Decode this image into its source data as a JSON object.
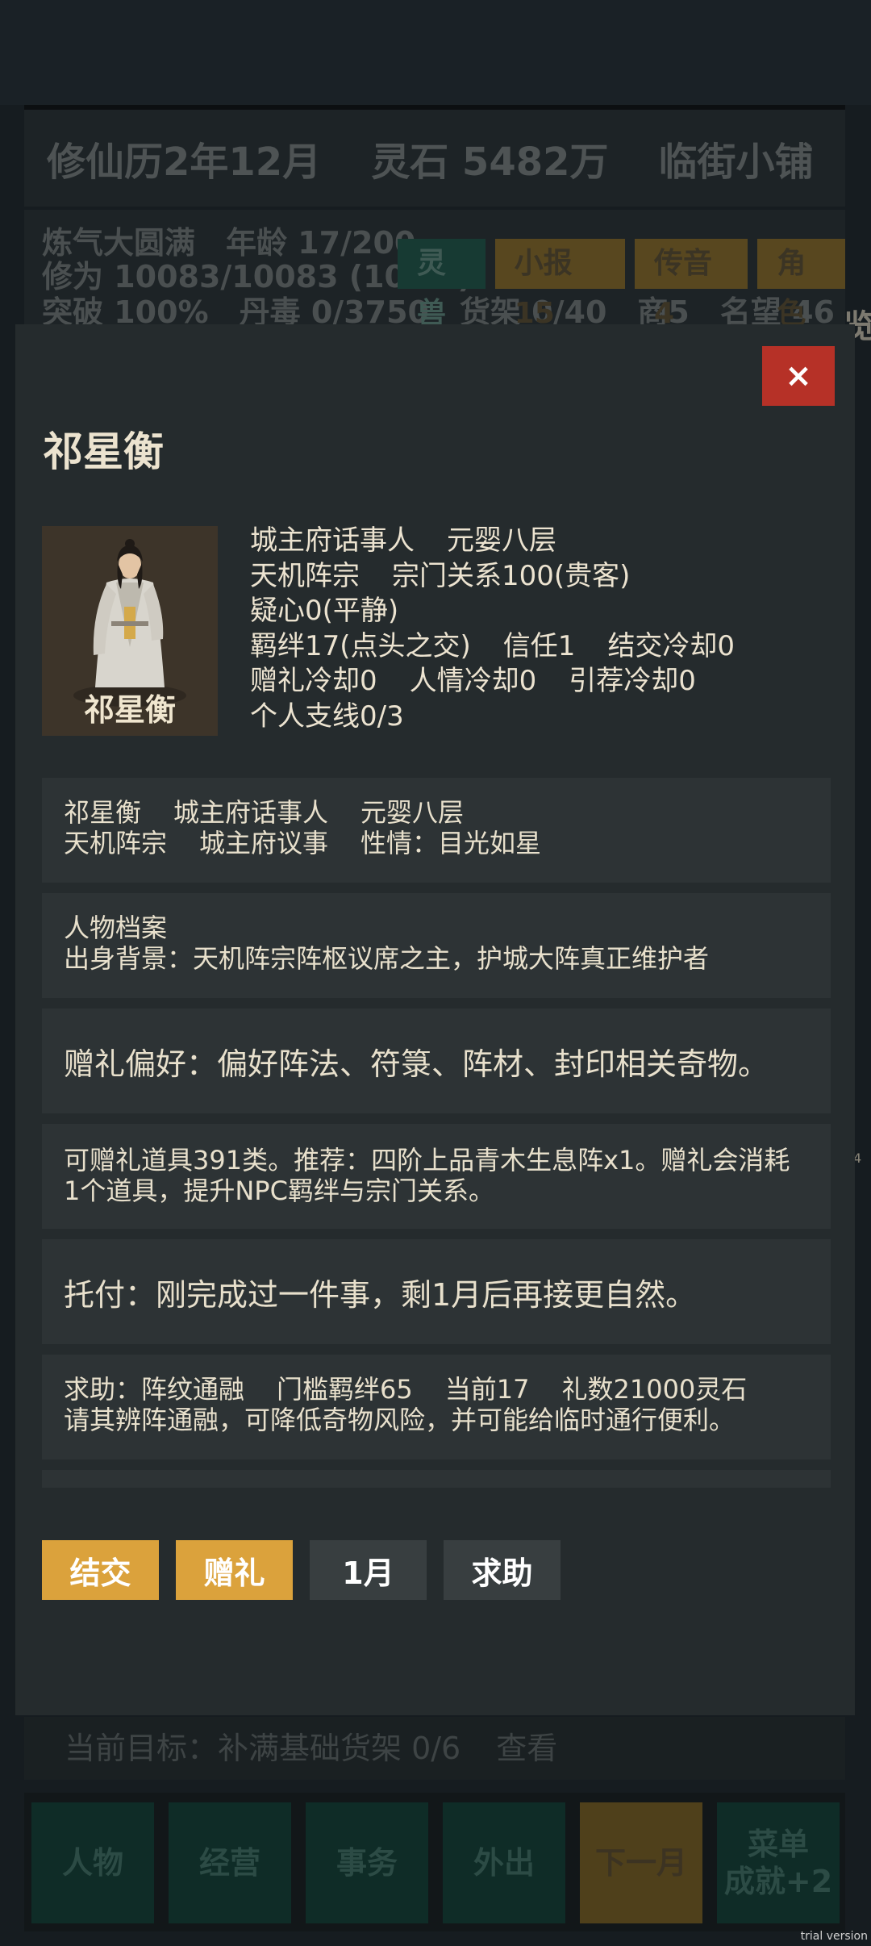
{
  "background": {
    "header": {
      "calendar": "修仙历2年12月",
      "spirit_stones": "灵石 5482万",
      "shop": "临街小铺"
    },
    "stats": {
      "line1": [
        "炼气大圆满",
        "年龄 17/200"
      ],
      "line2": "修为 10083/10083 (100%)",
      "line3": [
        "突破 100%",
        "丹毒 0/3750",
        "货架 0/40",
        "商5",
        "名望 46"
      ]
    },
    "tags": [
      "灵兽",
      "小报 15",
      "传音 4",
      "角色"
    ],
    "edge_glyph": "览",
    "edge_small": "4",
    "goal": {
      "text": "当前目标：补满基础货架 0/6",
      "link": "查看"
    },
    "nav": {
      "person": "人物",
      "business": "经营",
      "affairs": "事务",
      "outing": "外出",
      "next_month": "下一月",
      "menu_line1": "菜单",
      "menu_line2": "成就+2"
    },
    "watermark": "trial version"
  },
  "modal": {
    "close": "×",
    "name": "祁星衡",
    "portrait_caption": "祁星衡",
    "info": {
      "role": "城主府话事人",
      "realm": "元婴八层",
      "sect": "天机阵宗",
      "sect_relation": "宗门关系100(贵客)",
      "suspicion": "疑心0(平静)",
      "bond": "羁绊17(点头之交)",
      "trust": "信任1",
      "befriend_cd": "结交冷却0",
      "gift_cd": "赠礼冷却0",
      "favor_cd": "人情冷却0",
      "recommend_cd": "引荐冷却0",
      "storyline": "个人支线0/3"
    },
    "card1": {
      "name": "祁星衡",
      "role": "城主府话事人",
      "realm": "元婴八层",
      "sect": "天机阵宗",
      "duty": "城主府议事",
      "temper": "性情：目光如星"
    },
    "card2": {
      "title": "人物档案",
      "background": "出身背景：天机阵宗阵枢议席之主，护城大阵真正维护者"
    },
    "card3": {
      "text": "赠礼偏好：偏好阵法、符箓、阵材、封印相关奇物。"
    },
    "card4": {
      "line1": "可赠礼道具391类。推荐：四阶上品青木生息阵x1。赠礼会消耗",
      "line2": "1个道具，提升NPC羁绊与宗门关系。"
    },
    "card5": {
      "text": "托付：刚完成过一件事，剩1月后再接更自然。"
    },
    "card6": {
      "a": "求助：阵纹通融",
      "b": "门槛羁绊65",
      "c": "当前17",
      "d": "礼数21000灵石",
      "line2": "请其辨阵通融，可降低奇物风险，并可能给临时通行便利。"
    },
    "actions": {
      "befriend": "结交",
      "gift": "赠礼",
      "month": "1月",
      "help": "求助"
    }
  }
}
